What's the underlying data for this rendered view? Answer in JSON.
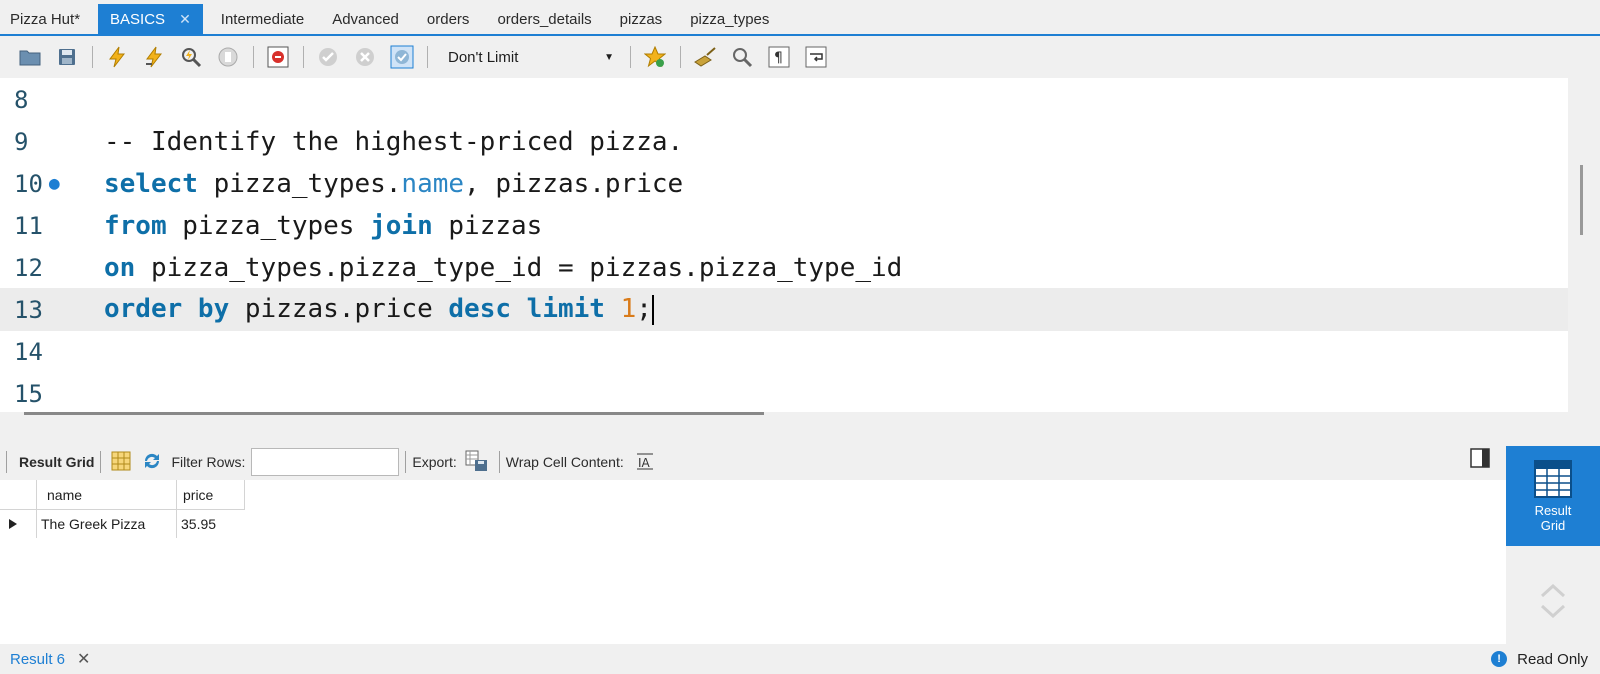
{
  "tabs": [
    {
      "label": "Pizza Hut*",
      "active": false
    },
    {
      "label": "BASICS",
      "active": true
    },
    {
      "label": "Intermediate",
      "active": false
    },
    {
      "label": "Advanced",
      "active": false
    },
    {
      "label": "orders",
      "active": false
    },
    {
      "label": "orders_details",
      "active": false
    },
    {
      "label": "pizzas",
      "active": false
    },
    {
      "label": "pizza_types",
      "active": false
    }
  ],
  "toolbar": {
    "limit_value": "Don't Limit"
  },
  "editor": {
    "lines": [
      {
        "num": "8"
      },
      {
        "num": "9"
      },
      {
        "num": "10"
      },
      {
        "num": "11"
      },
      {
        "num": "12"
      },
      {
        "num": "13"
      },
      {
        "num": "14"
      },
      {
        "num": "15"
      }
    ],
    "comment": "-- Identify the highest-priced pizza.",
    "l10_kw": "select",
    "l10_a": " pizza_types.",
    "l10_name": "name",
    "l10_b": ", pizzas.price",
    "l11_kw": "from",
    "l11_a": " pizza_types ",
    "l11_join": "join",
    "l11_b": " pizzas",
    "l12_kw": "on",
    "l12_a": " pizza_types.pizza_type_id = pizzas.pizza_type_id",
    "l13_kw": "order by",
    "l13_a": " pizzas.price ",
    "l13_desc": "desc",
    "l13_limit": "limit",
    "l13_num": "1",
    "l13_end": ";"
  },
  "result_toolbar": {
    "result_grid": "Result Grid",
    "filter_rows": "Filter Rows:",
    "export": "Export:",
    "wrap": "Wrap Cell Content:"
  },
  "grid": {
    "columns": [
      "name",
      "price"
    ],
    "rows": [
      [
        "The Greek Pizza",
        "35.95"
      ]
    ]
  },
  "side_panel": {
    "line1": "Result",
    "line2": "Grid"
  },
  "status": {
    "result_tab": "Result 6",
    "read_only": "Read Only"
  },
  "colors": {
    "accent": "#1e7fd3",
    "keyword": "#0e6fa8",
    "comment": "#2b86c4",
    "number": "#d97b1a"
  }
}
